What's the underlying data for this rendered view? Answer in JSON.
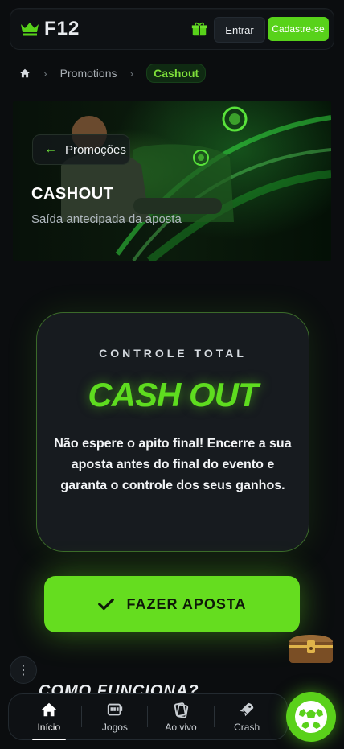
{
  "header": {
    "brand": "F12",
    "enter_label": "Entrar",
    "signup_label": "Cadastre-se",
    "icons": [
      "crown-logo-icon",
      "gift-icon"
    ],
    "accent_color": "#58d21a"
  },
  "breadcrumb": {
    "items": [
      "Promotions",
      "Cashout"
    ],
    "home_icon": "home-icon"
  },
  "hero": {
    "back_label": "Promoções",
    "title": "CASHOUT",
    "subtitle": "Saída antecipada da aposta"
  },
  "card": {
    "kicker": "CONTROLE TOTAL",
    "title": "CASH OUT",
    "text": "Não espere o apito final! Encerre a sua aposta antes do final do evento e garanta o controle dos seus ganhos."
  },
  "cta": {
    "label": "FAZER APOSTA",
    "icon": "check-icon"
  },
  "section": {
    "title": "COMO FUNCIONA?"
  },
  "bottom_nav": {
    "items": [
      {
        "label": "Início",
        "icon": "home-icon"
      },
      {
        "label": "Jogos",
        "icon": "slot-machine-icon"
      },
      {
        "label": "Ao vivo",
        "icon": "cards-icon"
      },
      {
        "label": "Crash",
        "icon": "rocket-icon"
      }
    ],
    "fab_icon": "soccer-ball-icon"
  },
  "colors": {
    "background": "#0b0d0f",
    "accent": "#65dd1f",
    "card_border": "#3b6a2a"
  }
}
